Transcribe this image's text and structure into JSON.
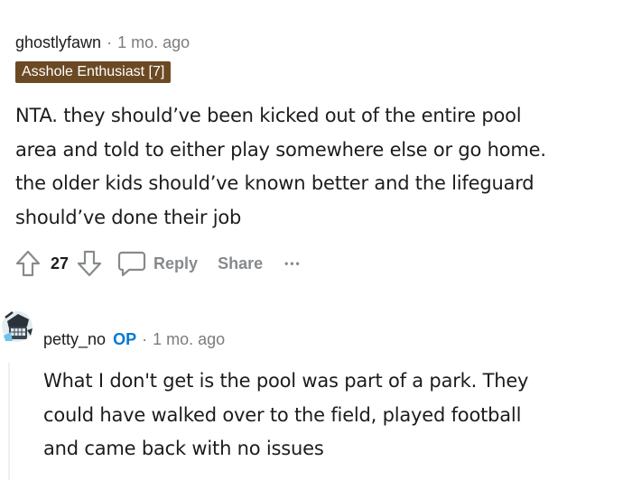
{
  "comment1": {
    "author": "ghostlyfawn",
    "separator": "·",
    "time": "1 mo. ago",
    "flair": "Asshole Enthusiast [7]",
    "body": "NTA. they should’ve been kicked out of the entire pool\narea and told to either play somewhere else or go home.\nthe older kids should’ve known better and the lifeguard\nshould’ve done their job",
    "score": "27",
    "actions": {
      "reply": "Reply",
      "share": "Share",
      "more": "•••"
    }
  },
  "comment2": {
    "author": "petty_no",
    "op_tag": "OP",
    "separator": "·",
    "time": "1 mo. ago",
    "body": "What I don't get is the pool was part of a park. They\ncould have walked over to the field, played football\nand came back with no issues"
  },
  "colors": {
    "flair_bg": "#6b4a23",
    "op_blue": "#0079d3",
    "muted": "#7c7c7c",
    "action_grey": "#878a8c"
  },
  "icons": [
    "upvote-icon",
    "downvote-icon",
    "comment-bubble-icon",
    "more-dots-icon",
    "avatar-icon"
  ]
}
